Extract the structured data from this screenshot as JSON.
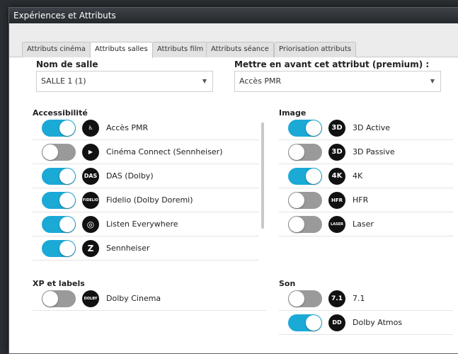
{
  "window": {
    "title": "Expériences et Attributs"
  },
  "tabs": [
    {
      "label": "Attributs cinéma",
      "active": false
    },
    {
      "label": "Attributs salles",
      "active": true
    },
    {
      "label": "Attributs film",
      "active": false
    },
    {
      "label": "Attributs séance",
      "active": false
    },
    {
      "label": "Priorisation attributs",
      "active": false
    }
  ],
  "salle": {
    "label": "Nom de salle",
    "value": "SALLE 1 (1)"
  },
  "premium": {
    "label": "Mettre en avant cet attribut (premium) :",
    "value": "Accès PMR"
  },
  "sections": {
    "accessibilite": {
      "title": "Accessibilité",
      "items": [
        {
          "label": "Accès PMR",
          "on": true,
          "icon": "wheelchair-icon"
        },
        {
          "label": "Cinéma Connect (Sennheiser)",
          "on": false,
          "icon": "cinema-connect-icon"
        },
        {
          "label": "DAS (Dolby)",
          "on": true,
          "icon": "das-icon",
          "badge": "DAS"
        },
        {
          "label": "Fidelio (Dolby Doremi)",
          "on": true,
          "icon": "fidelio-icon",
          "badge": "FIDELIO"
        },
        {
          "label": "Listen Everywhere",
          "on": true,
          "icon": "headphones-icon"
        },
        {
          "label": "Sennheiser",
          "on": true,
          "icon": "sennheiser-icon",
          "badge": "Z"
        }
      ]
    },
    "image": {
      "title": "Image",
      "items": [
        {
          "label": "3D Active",
          "on": true,
          "icon": "3d-active-icon",
          "badge": "3D"
        },
        {
          "label": "3D Passive",
          "on": false,
          "icon": "3d-passive-icon",
          "badge": "3D"
        },
        {
          "label": "4K",
          "on": true,
          "icon": "4k-icon",
          "badge": "4K"
        },
        {
          "label": "HFR",
          "on": false,
          "icon": "hfr-icon",
          "badge": "HFR"
        },
        {
          "label": "Laser",
          "on": false,
          "icon": "laser-icon",
          "badge": "LASER"
        }
      ]
    },
    "xp": {
      "title": "XP et labels",
      "items": [
        {
          "label": "Dolby Cinema",
          "on": false,
          "icon": "dolby-cinema-icon",
          "badge": "DOLBY"
        }
      ]
    },
    "son": {
      "title": "Son",
      "items": [
        {
          "label": "7.1",
          "on": false,
          "icon": "7-1-icon",
          "badge": "7.1"
        },
        {
          "label": "Dolby Atmos",
          "on": true,
          "icon": "dolby-atmos-icon",
          "badge": "DD"
        }
      ]
    }
  },
  "colors": {
    "toggle_on": "#1ba9d6",
    "toggle_off": "#9a9a9a"
  }
}
